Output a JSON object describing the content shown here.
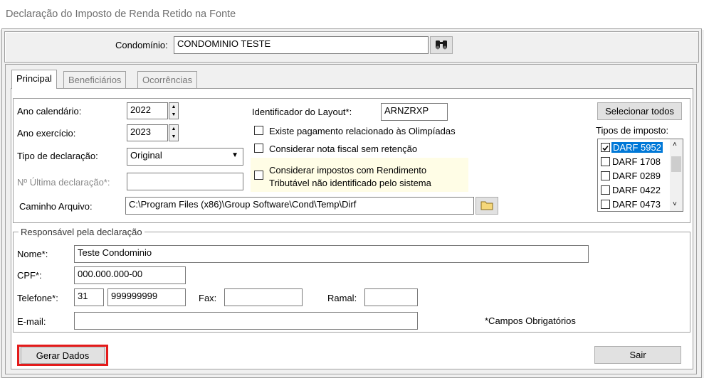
{
  "window": {
    "title": "Declaração do Imposto de Renda Retido na Fonte"
  },
  "top": {
    "condominio_label": "Condomínio:",
    "condominio_value": "CONDOMINIO TESTE"
  },
  "tabs": [
    {
      "label": "Principal"
    },
    {
      "label": "Beneficiários"
    },
    {
      "label": "Ocorrências"
    }
  ],
  "principal": {
    "ano_calendario_label": "Ano calendário:",
    "ano_calendario_value": "2022",
    "ano_exercicio_label": "Ano exercício:",
    "ano_exercicio_value": "2023",
    "tipo_declaracao_label": "Tipo de declaração:",
    "tipo_declaracao_value": "Original",
    "ultima_declaracao_label": "Nº Última declaração*:",
    "ultima_declaracao_value": "",
    "caminho_label": "Caminho Arquivo:",
    "caminho_value": "C:\\Program Files (x86)\\Group Software\\Cond\\Temp\\Dirf",
    "layout_label": "Identificador do Layout*:",
    "layout_value": "ARNZRXP",
    "chk_olimpiadas": "Existe pagamento relacionado às Olimpíadas",
    "chk_nota_fiscal": "Considerar nota fiscal sem retenção",
    "chk_rendimento_line1": "Considerar impostos com Rendimento",
    "chk_rendimento_line2": "Tributável não identificado pelo sistema",
    "selecionar_todos": "Selecionar todos",
    "tipos_imposto_label": "Tipos de imposto:",
    "tipos_imposto": [
      {
        "label": "DARF 5952",
        "checked": true,
        "selected": true
      },
      {
        "label": "DARF 1708",
        "checked": false
      },
      {
        "label": "DARF 0289",
        "checked": false
      },
      {
        "label": "DARF 0422",
        "checked": false
      },
      {
        "label": "DARF 0473",
        "checked": false
      }
    ]
  },
  "responsavel": {
    "group_title": "Responsável pela declaração",
    "nome_label": "Nome*:",
    "nome_value": "Teste Condominio",
    "cpf_label": "CPF*:",
    "cpf_value": "000.000.000-00",
    "telefone_label": "Telefone*:",
    "ddd_value": "31",
    "telefone_value": "999999999",
    "fax_label": "Fax:",
    "fax_value": "",
    "ramal_label": "Ramal:",
    "ramal_value": "",
    "email_label": "E-mail:",
    "email_value": "",
    "campos_obrigatorios": "*Campos Obrigatórios"
  },
  "footer": {
    "gerar_dados": "Gerar Dados",
    "sair": "Sair"
  }
}
